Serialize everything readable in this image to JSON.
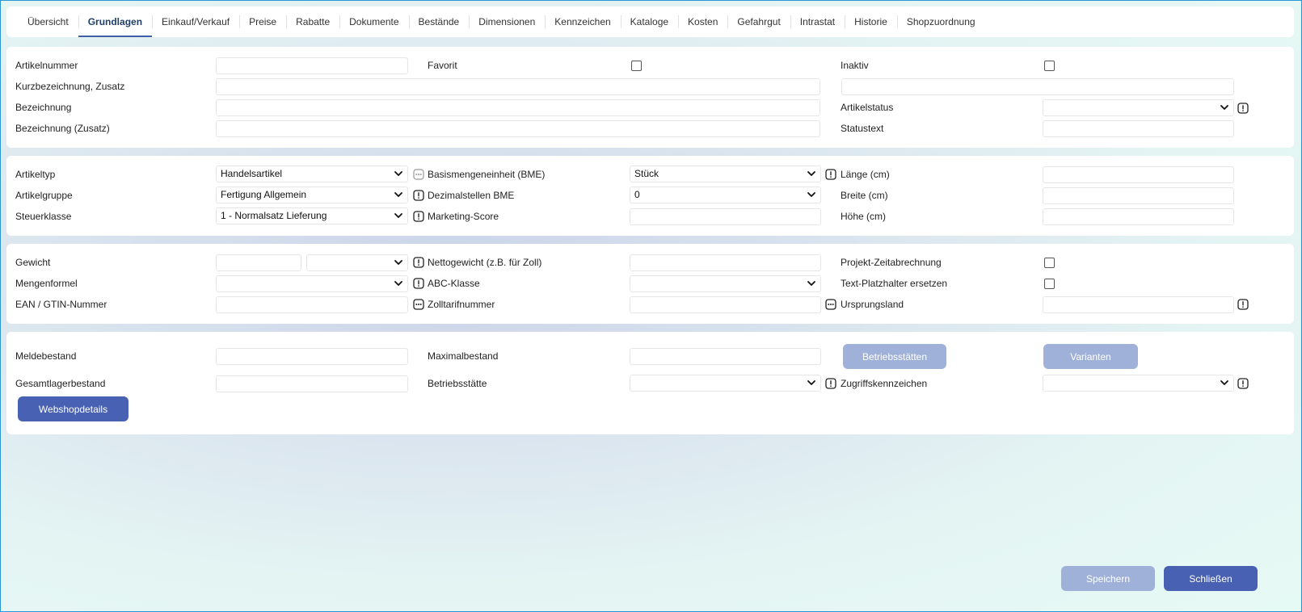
{
  "tabs": [
    "Übersicht",
    "Grundlagen",
    "Einkauf/Verkauf",
    "Preise",
    "Rabatte",
    "Dokumente",
    "Bestände",
    "Dimensionen",
    "Kennzeichen",
    "Kataloge",
    "Kosten",
    "Gefahrgut",
    "Intrastat",
    "Historie",
    "Shopzuordnung"
  ],
  "active_tab": "Grundlagen",
  "section1": {
    "artikelnummer": "Artikelnummer",
    "favorit": "Favorit",
    "inaktiv": "Inaktiv",
    "kurzbezeichnung": "Kurzbezeichnung, Zusatz",
    "bezeichnung": "Bezeichnung",
    "artikelstatus": "Artikelstatus",
    "bezeichnung_zusatz": "Bezeichnung (Zusatz)",
    "statustext": "Statustext"
  },
  "section2": {
    "artikeltyp": "Artikeltyp",
    "artikeltyp_value": "Handelsartikel",
    "bme": "Basismengeneinheit (BME)",
    "bme_value": "Stück",
    "laenge": "Länge (cm)",
    "artikelgruppe": "Artikelgruppe",
    "artikelgruppe_value": "Fertigung Allgemein",
    "dezimalstellen": "Dezimalstellen BME",
    "dezimalstellen_value": "0",
    "breite": "Breite (cm)",
    "steuerklasse": "Steuerklasse",
    "steuerklasse_value": "1 - Normalsatz Lieferung",
    "marketing": "Marketing-Score",
    "hoehe": "Höhe (cm)"
  },
  "section3": {
    "gewicht": "Gewicht",
    "nettogewicht": "Nettogewicht (z.B. für Zoll)",
    "projekt": "Projekt-Zeitabrechnung",
    "mengenformel": "Mengenformel",
    "abc": "ABC-Klasse",
    "platzhalter": "Text-Platzhalter ersetzen",
    "ean": "EAN / GTIN-Nummer",
    "zolltarif": "Zolltarifnummer",
    "ursprungsland": "Ursprungsland"
  },
  "section4": {
    "meldebestand": "Meldebestand",
    "maximalbestand": "Maximalbestand",
    "betriebsstaetten_btn": "Betriebsstätten",
    "varianten_btn": "Varianten",
    "gesamtlager": "Gesamtlagerbestand",
    "betriebsstaette": "Betriebsstätte",
    "zugriff": "Zugriffskennzeichen",
    "webshop_btn": "Webshopdetails"
  },
  "footer": {
    "save": "Speichern",
    "close": "Schließen"
  },
  "colors": {
    "accent": "#4861b2",
    "accent_disabled": "#9fb1d8",
    "tab_text_active": "#1f3f66",
    "frame": "#2a97d4"
  }
}
